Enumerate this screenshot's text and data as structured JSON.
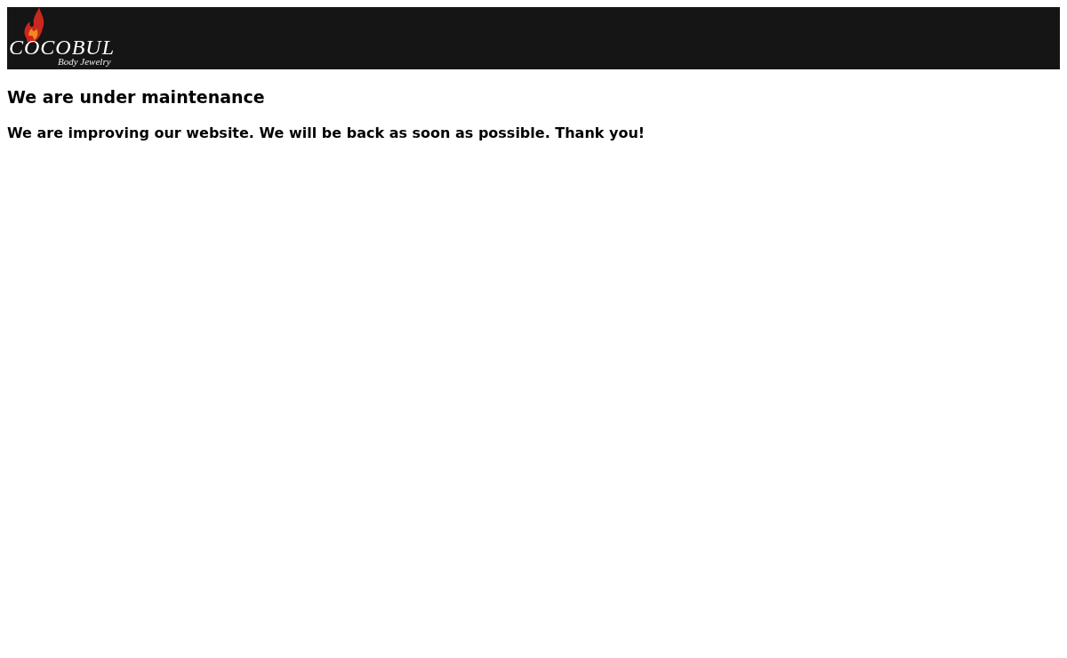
{
  "header": {
    "logo": {
      "name": "COCOBUL",
      "tagline": "Body Jewelry"
    }
  },
  "heading": "We are under maintenance",
  "message": "We are improving our website. We will be back as soon as possible. Thank you!"
}
